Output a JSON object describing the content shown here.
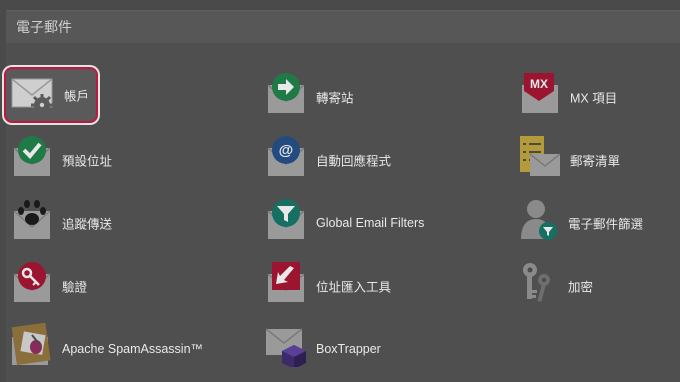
{
  "section": {
    "title": "電子郵件"
  },
  "items": [
    {
      "id": "accounts",
      "label": "帳戶",
      "icon": "email-accounts-gear-icon"
    },
    {
      "id": "forwarders",
      "label": "轉寄站",
      "icon": "forwarder-arrow-icon"
    },
    {
      "id": "mx",
      "label": "MX 項目",
      "icon": "mx-entry-icon"
    },
    {
      "id": "default-address",
      "label": "預設位址",
      "icon": "checkmark-envelope-icon"
    },
    {
      "id": "autoresponders",
      "label": "自動回應程式",
      "icon": "at-sign-envelope-icon"
    },
    {
      "id": "mailing-lists",
      "label": "郵寄清單",
      "icon": "mailing-list-icon"
    },
    {
      "id": "track-delivery",
      "label": "追蹤傳送",
      "icon": "paw-print-envelope-icon"
    },
    {
      "id": "global-filters",
      "label": "Global Email Filters",
      "icon": "funnel-envelope-icon"
    },
    {
      "id": "email-filters",
      "label": "電子郵件篩選",
      "icon": "user-filter-icon"
    },
    {
      "id": "authentication",
      "label": "驗證",
      "icon": "key-envelope-icon"
    },
    {
      "id": "import",
      "label": "位址匯入工具",
      "icon": "import-arrow-envelope-icon"
    },
    {
      "id": "encryption",
      "label": "加密",
      "icon": "keys-icon"
    },
    {
      "id": "spamassassin",
      "label": "Apache SpamAssassin™",
      "icon": "spamassassin-icon"
    },
    {
      "id": "boxtrapper",
      "label": "BoxTrapper",
      "icon": "boxtrapper-cube-icon"
    }
  ],
  "colors": {
    "highlight_border": "#c0173f",
    "envelope": "#c8c8c8",
    "green": "#2a9a57",
    "blue": "#2f63a8",
    "red": "#b8163a",
    "teal": "#1d9a88"
  }
}
